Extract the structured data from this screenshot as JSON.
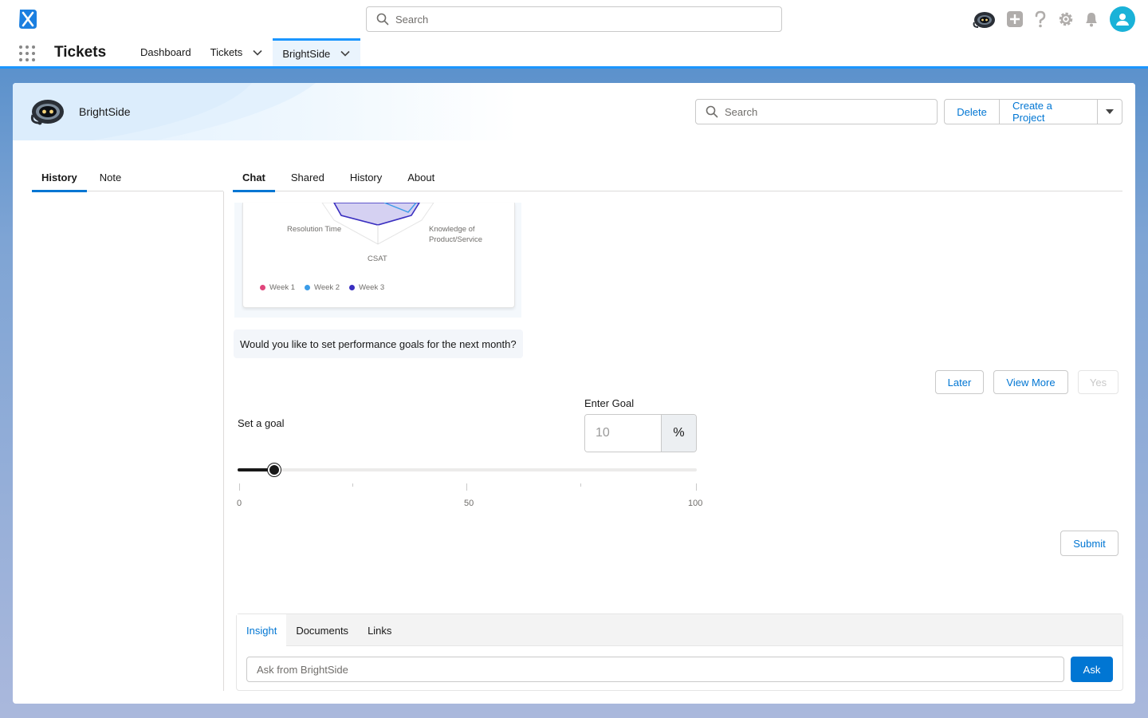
{
  "global_header": {
    "search_placeholder": "Search",
    "icons": [
      "app-logo-icon",
      "bot-icon",
      "add-icon",
      "help-icon",
      "settings-icon",
      "notification-icon",
      "user-avatar-icon"
    ]
  },
  "nav": {
    "app_name": "Tickets",
    "items": [
      {
        "label": "Dashboard"
      },
      {
        "label": "Tickets"
      },
      {
        "label": "BrightSide"
      }
    ]
  },
  "record": {
    "title": "BrightSide",
    "search_placeholder": "Search",
    "actions": {
      "delete": "Delete",
      "create": "Create a Project"
    }
  },
  "left_panel": {
    "tabs": [
      {
        "label": "History"
      },
      {
        "label": "Note"
      }
    ]
  },
  "right_panel": {
    "tabs": [
      {
        "label": "Chat"
      },
      {
        "label": "Shared"
      },
      {
        "label": "History"
      },
      {
        "label": "About"
      }
    ]
  },
  "chart": {
    "axes": [
      "Resolution Time",
      "Knowledge of Product/Service",
      "CSAT"
    ],
    "legend": [
      {
        "name": "Week 1",
        "color": "#e0457b"
      },
      {
        "name": "Week 2",
        "color": "#3b9ce8"
      },
      {
        "name": "Week 3",
        "color": "#3a2fc0"
      }
    ]
  },
  "chat": {
    "question": "Would you like to set performance goals for the next month?",
    "buttons": {
      "later": "Later",
      "view_more": "View More",
      "yes": "Yes"
    },
    "goal_label": "Set a goal",
    "enter_goal_label": "Enter Goal",
    "goal_placeholder": "10",
    "goal_unit": "%",
    "slider": {
      "min": 0,
      "max": 100,
      "value": 8,
      "tick_labels": [
        "0",
        "50",
        "100"
      ]
    },
    "submit": "Submit"
  },
  "composer": {
    "tabs": [
      {
        "label": "Insight"
      },
      {
        "label": "Documents"
      },
      {
        "label": "Links"
      }
    ],
    "input_placeholder": "Ask from BrightSide",
    "ask": "Ask"
  },
  "colors": {
    "brand": "#0176d3",
    "accent": "#1b96ff",
    "avatar": "#1ab2d8"
  }
}
